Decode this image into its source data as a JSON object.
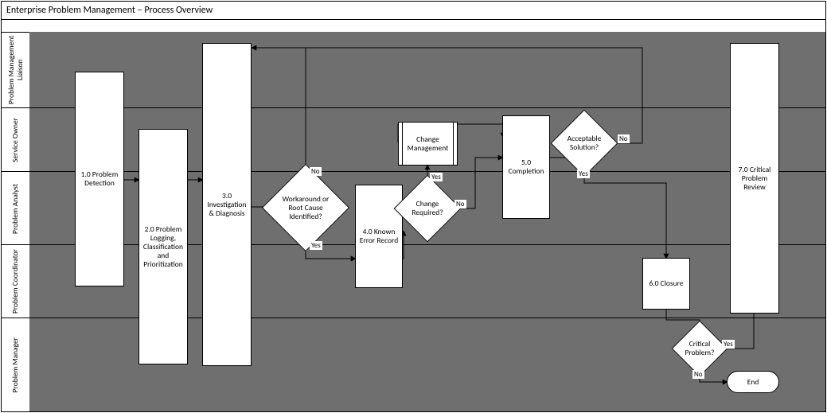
{
  "title": "Enterprise Problem Management – Process Overview",
  "lanes": {
    "l0": "Problem Management Liaison",
    "l1": "Service Owner",
    "l2": "Problem Analyst",
    "l3": "Problem Coordinator",
    "l4": "Problem Manager"
  },
  "nodes": {
    "detect": "1.0 Problem Detection",
    "log": "2.0 Problem Logging, Classification and Prioritization",
    "inv": "3.0 Investigation & Diagnosis",
    "wrk": "Workaround or Root Cause Identified?",
    "ker": "4.0 Known Error Record",
    "chg": "Change Required?",
    "cm": "Change Management",
    "comp": "5.0 Completion",
    "acc": "Acceptable Solution?",
    "clo": "6.0 Closure",
    "crit": "Critical Problem?",
    "rev": "7.0 Critical Problem Review",
    "end": "End"
  },
  "labels": {
    "yes": "Yes",
    "no": "No"
  }
}
